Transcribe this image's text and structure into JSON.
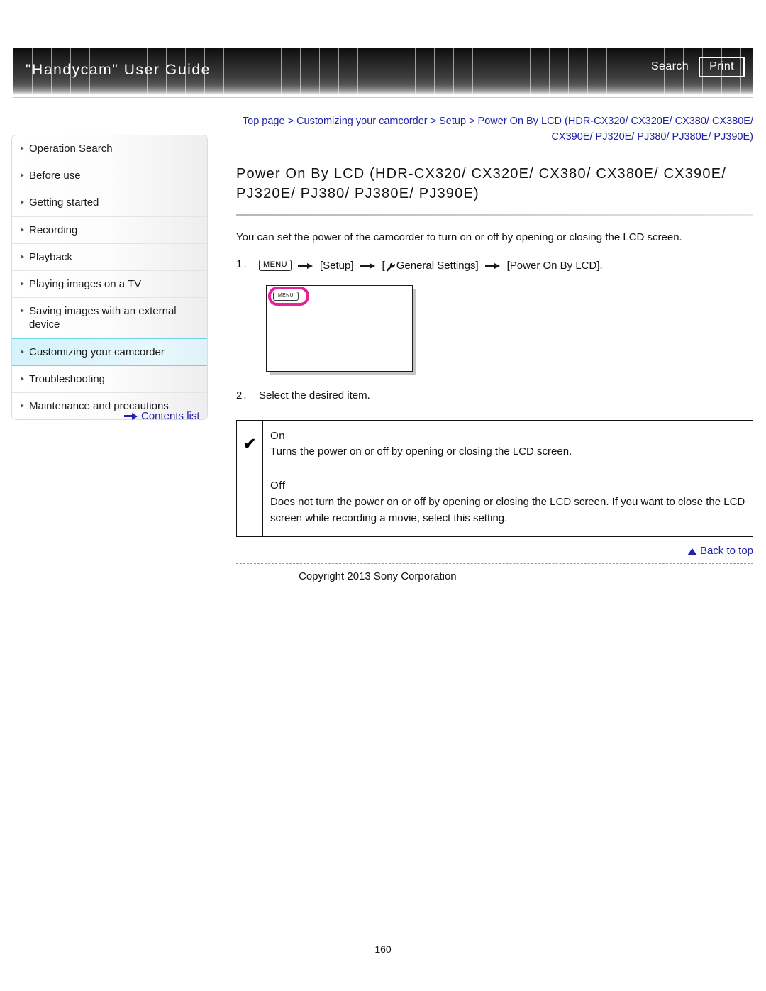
{
  "header": {
    "title": "\"Handycam\" User Guide",
    "search_label": "Search",
    "print_label": "Print"
  },
  "sidebar": {
    "items": [
      {
        "label": "Operation Search",
        "active": false
      },
      {
        "label": "Before use",
        "active": false
      },
      {
        "label": "Getting started",
        "active": false
      },
      {
        "label": "Recording",
        "active": false
      },
      {
        "label": "Playback",
        "active": false
      },
      {
        "label": "Playing images on a TV",
        "active": false
      },
      {
        "label": "Saving images with an external device",
        "active": false
      },
      {
        "label": "Customizing your camcorder",
        "active": true
      },
      {
        "label": "Troubleshooting",
        "active": false
      },
      {
        "label": "Maintenance and precautions",
        "active": false
      }
    ],
    "contents_list_label": "Contents list"
  },
  "main": {
    "breadcrumb": "Top page > Customizing your camcorder > Setup > Power On By LCD (HDR-CX320/ CX320E/ CX380/ CX380E/ CX390E/ PJ320E/ PJ380/ PJ380E/ PJ390E)",
    "page_title": "Power On By LCD (HDR-CX320/ CX320E/ CX380/ CX380E/ CX390E/ PJ320E/ PJ380/ PJ380E/ PJ390E)",
    "intro": "You can set the power of the camcorder to turn on or off by opening or closing the LCD screen.",
    "step1": {
      "number": "1.",
      "menu_chip": "MENU",
      "part_setup": "[Setup]",
      "part_general": "General Settings]",
      "bracket_open": "[",
      "part_power": "[Power On By LCD]."
    },
    "lcd_figure": {
      "menu_chip": "MENU"
    },
    "step2": {
      "number": "2.",
      "text": "Select the desired item."
    },
    "options_table": {
      "rows": [
        {
          "checked": "✔",
          "name": "On",
          "description": "Turns the power on or off by opening or closing the LCD screen."
        },
        {
          "checked": "",
          "name": "Off",
          "description": "Does not turn the power on or off by opening or closing the LCD screen. If you want to close the LCD screen while recording a movie, select this setting."
        }
      ]
    }
  },
  "footer": {
    "back_to_top_label": "Back to top",
    "copyright": "Copyright 2013 Sony Corporation",
    "page_number": "160"
  },
  "colors": {
    "link_blue": "#2222aa",
    "highlight_cyan": "#6fd3e8",
    "magenta_ring": "#e6219b"
  }
}
